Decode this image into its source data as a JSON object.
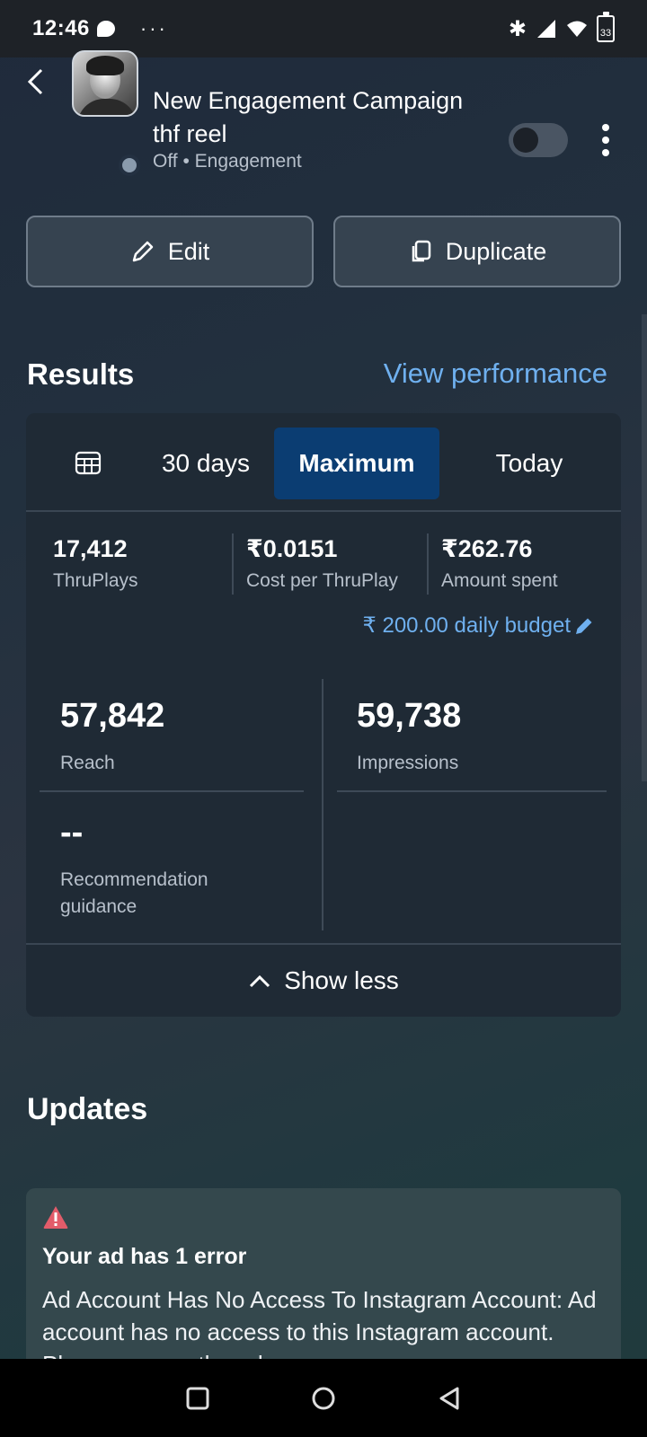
{
  "status_bar": {
    "time": "12:46",
    "overflow_dots": "···",
    "battery": "33"
  },
  "header": {
    "campaign_name": "New Engagement Campaign thf reel",
    "status_line": "Off • Engagement",
    "toggle_on": false
  },
  "actions": {
    "edit_label": "Edit",
    "duplicate_label": "Duplicate"
  },
  "results": {
    "title": "Results",
    "view_performance": "View performance",
    "ranges": [
      "30 days",
      "Maximum",
      "Today"
    ],
    "selected_range": "Maximum",
    "metrics": [
      {
        "value": "17,412",
        "label": "ThruPlays"
      },
      {
        "value": "₹0.0151",
        "label": "Cost per ThruPlay"
      },
      {
        "value": "₹262.76",
        "label": "Amount spent"
      }
    ],
    "daily_budget": "₹ 200.00 daily budget",
    "reach": {
      "value": "57,842",
      "label": "Reach"
    },
    "impressions": {
      "value": "59,738",
      "label": "Impressions"
    },
    "recommendation": {
      "value": "--",
      "label": "Recommendation guidance"
    },
    "show_less": "Show less"
  },
  "updates": {
    "title": "Updates",
    "error_title": "Your ad has 1 error",
    "error_body": "Ad Account Has No Access To Instagram Account: Ad account has no access to this Instagram account. Please ensure the ad"
  },
  "colors": {
    "accent_link": "#6fb0ef",
    "selected_range": "#0b3d72",
    "error": "#e25c6a"
  }
}
